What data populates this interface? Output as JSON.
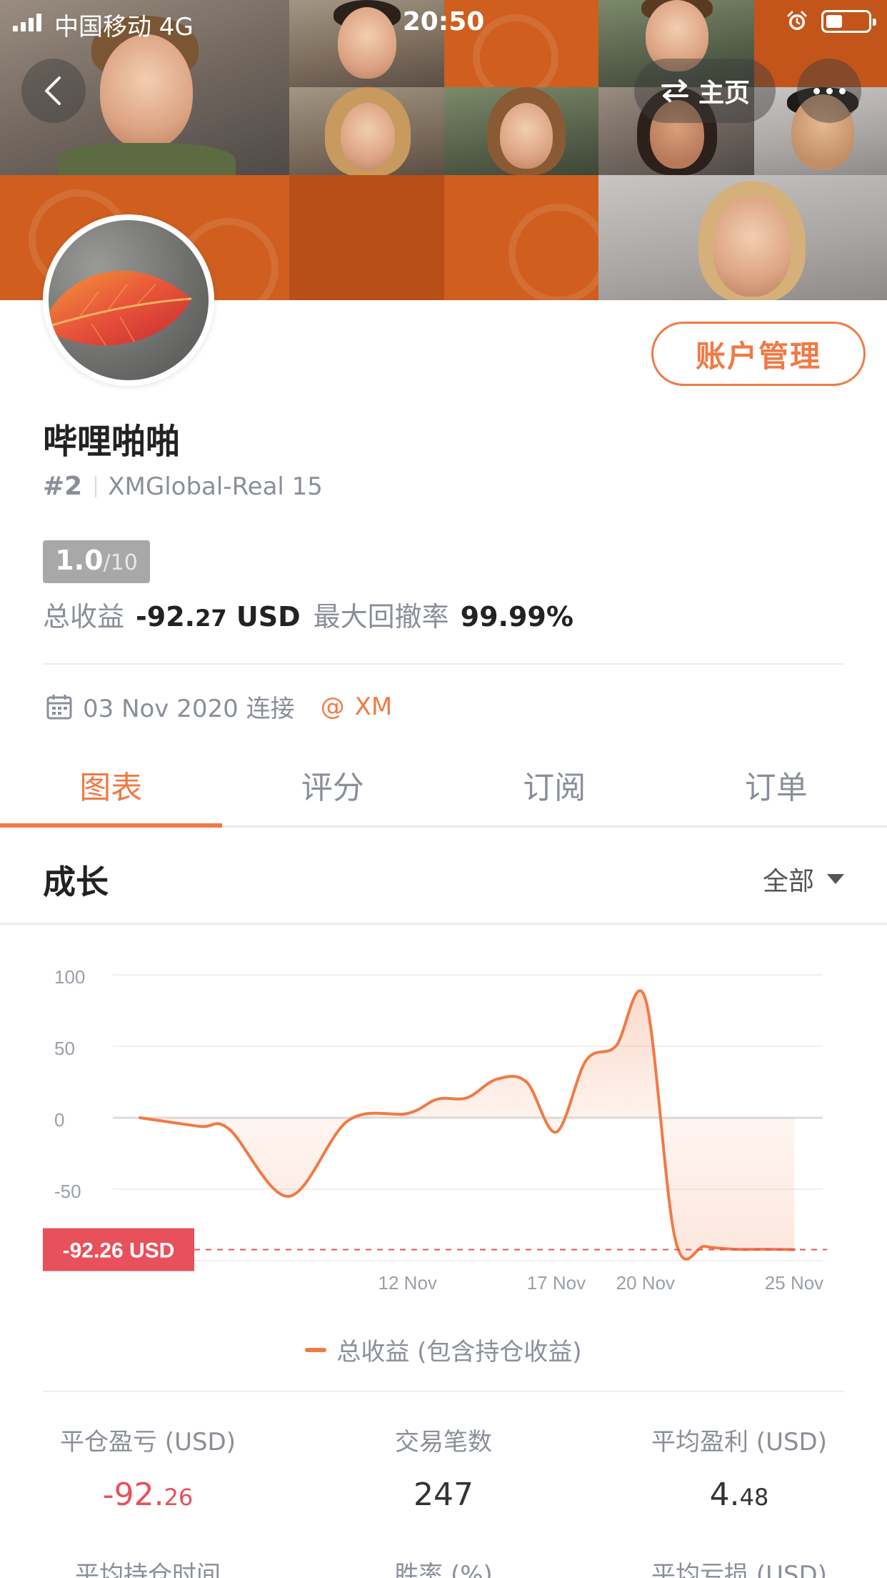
{
  "status_bar": {
    "carrier": "中国移动  4G",
    "time": "20:50"
  },
  "nav": {
    "home_label": "主页"
  },
  "profile": {
    "username": "哔哩啪啪",
    "rank": "#2",
    "server": "XMGlobal-Real 15",
    "score_main": "1.0",
    "score_total": "/10",
    "total_profit_label": "总收益",
    "total_profit_value": "-92.",
    "total_profit_decimals": "27",
    "total_profit_unit": " USD",
    "max_drawdown_label": "最大回撤率",
    "max_drawdown_value": "99.99%",
    "connected_date": "03 Nov 2020 连接",
    "broker_at": "@",
    "broker": "XM",
    "account_button": "账户管理"
  },
  "tabs": [
    "图表",
    "评分",
    "订阅",
    "订单"
  ],
  "section": {
    "title": "成长",
    "filter": "全部"
  },
  "chart_data": {
    "type": "area",
    "y_ticks": [
      "100",
      "50",
      "0",
      "-50"
    ],
    "ylim": [
      -100,
      100
    ],
    "x_ticks": [
      "12 Nov",
      "17 Nov",
      "20 Nov",
      "25 Nov"
    ],
    "x": [
      "03 Nov",
      "05 Nov",
      "06 Nov",
      "08 Nov",
      "10 Nov",
      "12 Nov",
      "13 Nov",
      "14 Nov",
      "15 Nov",
      "16 Nov",
      "17 Nov",
      "18 Nov",
      "19 Nov",
      "20 Nov",
      "21 Nov",
      "22 Nov",
      "23 Nov",
      "24 Nov",
      "25 Nov"
    ],
    "series": [
      {
        "name": "总收益 (包含持仓收益)",
        "values": [
          0,
          -6,
          -8,
          -55,
          -2,
          3,
          13,
          14,
          27,
          25,
          -10,
          40,
          50,
          83,
          -85,
          -90,
          -92,
          -92,
          -92.26
        ]
      }
    ],
    "current_value_label": "-92.26 USD",
    "current_value": -92.26,
    "legend": "总收益 (包含持仓收益)"
  },
  "bottom_stats": [
    {
      "label": "平仓盈亏 (USD)",
      "value": "-92.",
      "decimals": "26",
      "negative": true
    },
    {
      "label": "交易笔数",
      "value": "247",
      "decimals": "",
      "negative": false
    },
    {
      "label": "平均盈利 (USD)",
      "value": "4.",
      "decimals": "48",
      "negative": false
    }
  ],
  "bottom_stats_row2": [
    {
      "label": "平均持仓时间"
    },
    {
      "label": "胜率 (%)"
    },
    {
      "label": "平均亏损 (USD)"
    }
  ],
  "colors": {
    "accent": "#f07a45",
    "negative": "#e8505b",
    "muted": "#8a8f99"
  }
}
